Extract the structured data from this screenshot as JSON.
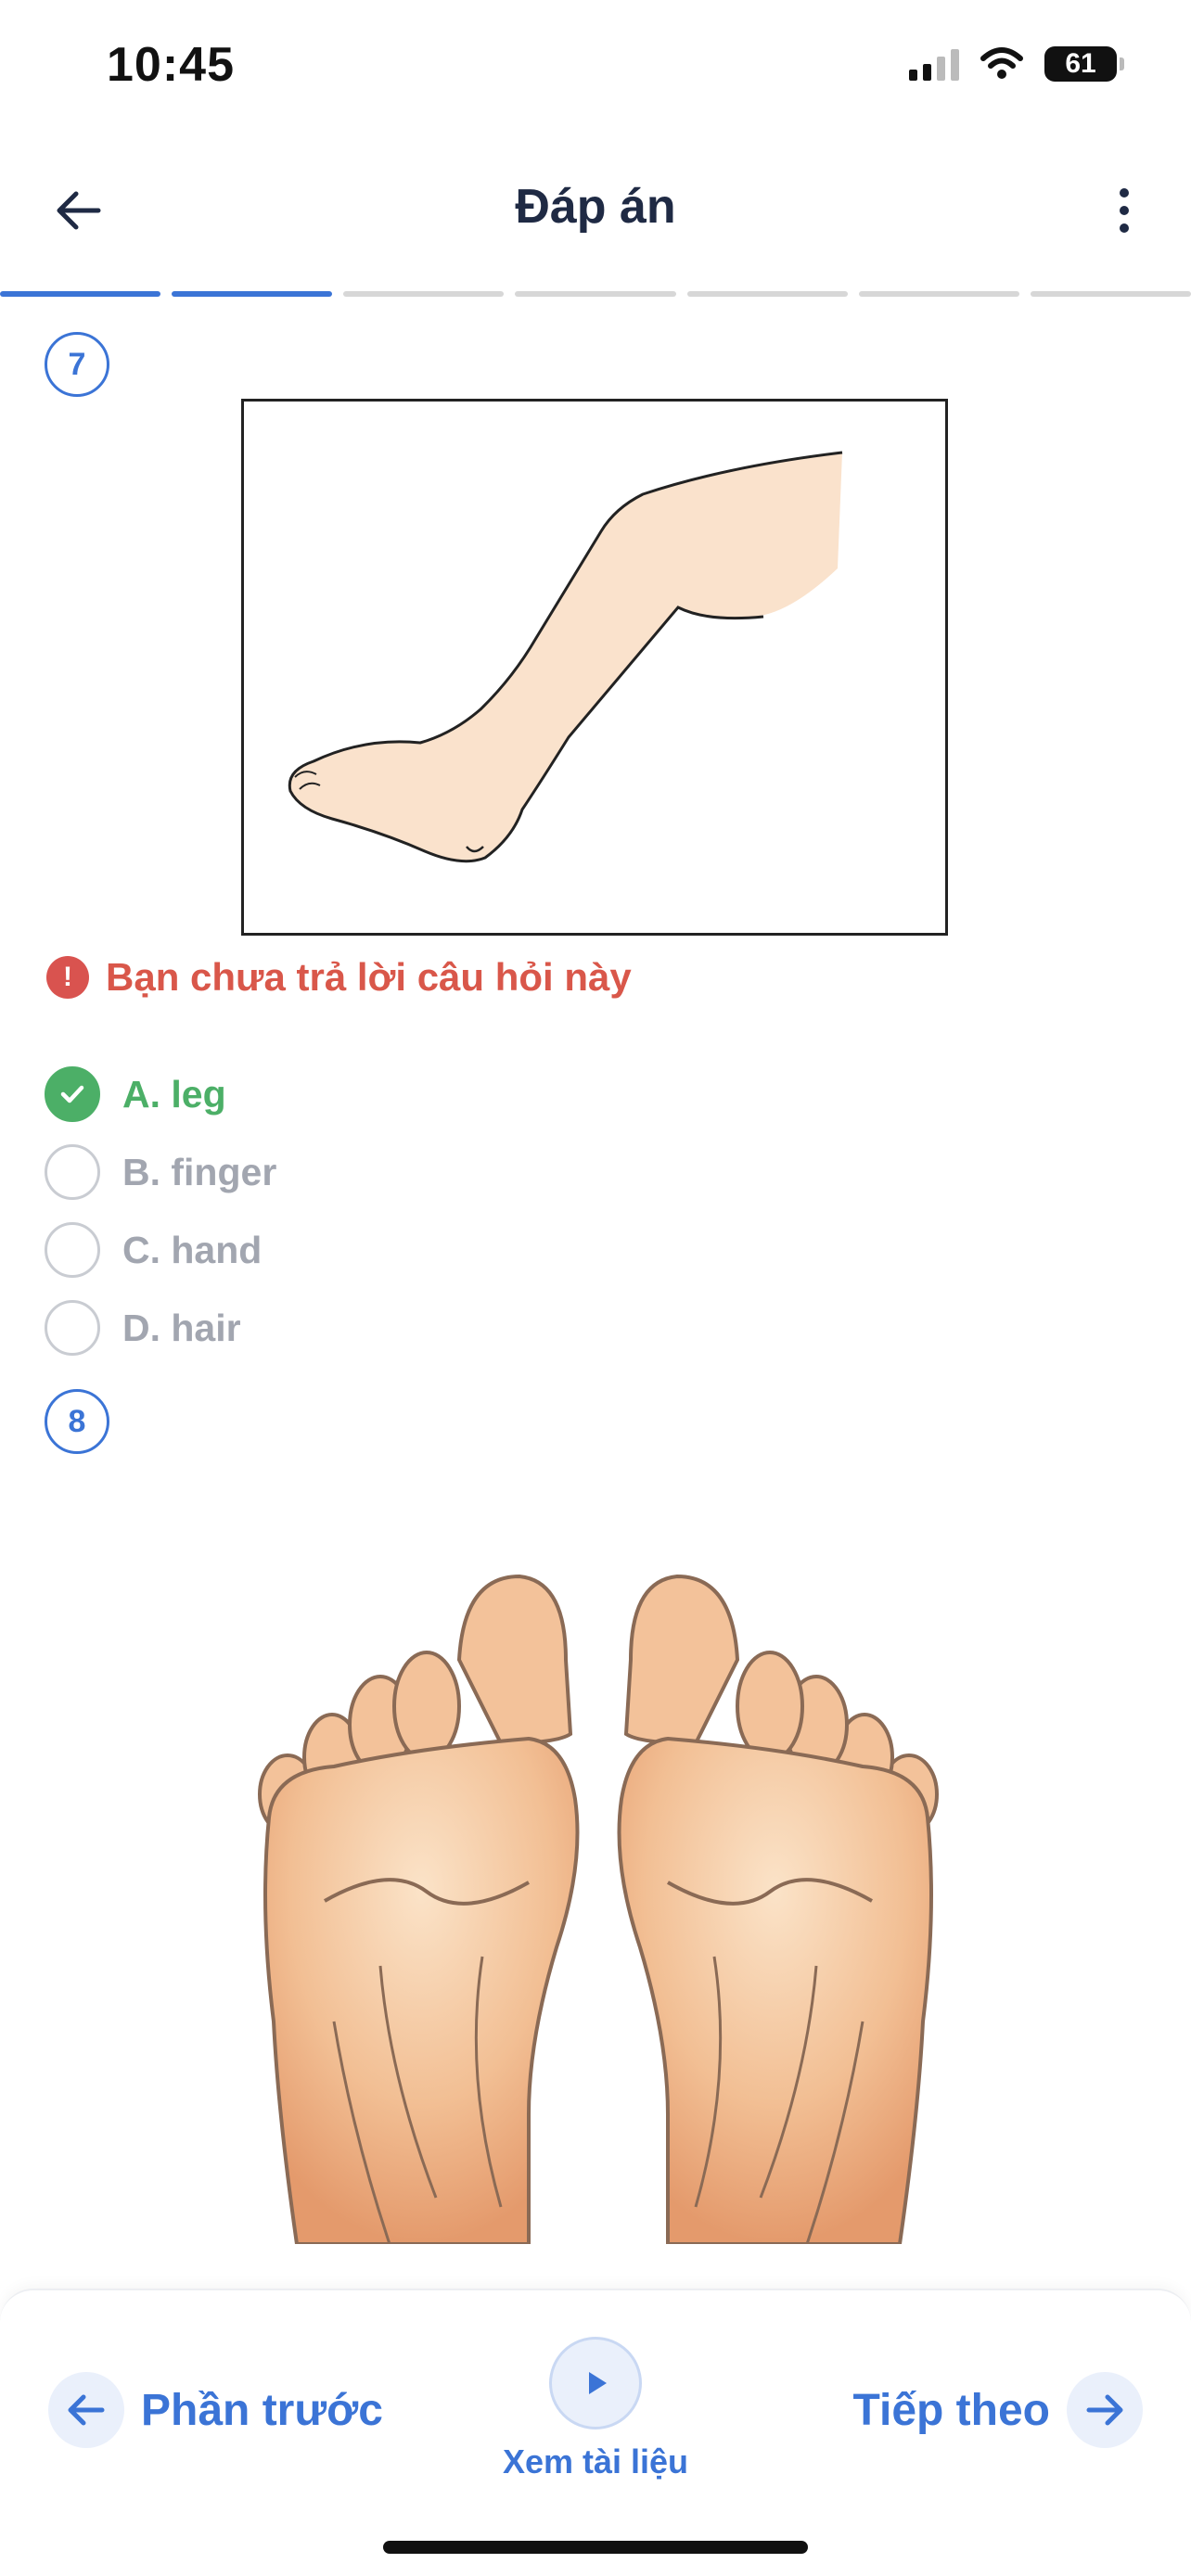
{
  "status_bar": {
    "time": "10:45",
    "battery": "61",
    "icons": [
      "signal-icon",
      "wifi-icon",
      "battery-icon"
    ]
  },
  "header": {
    "title": "Đáp án",
    "back_icon": "arrow-left-icon",
    "more_icon": "more-vertical-icon"
  },
  "progress": {
    "total_segments": 7,
    "completed_segments": 2
  },
  "questions": [
    {
      "number": "7",
      "image": "leg-illustration",
      "warning": "Bạn chưa trả lời câu hỏi này",
      "options": [
        {
          "label": "A. leg",
          "state": "correct"
        },
        {
          "label": "B. finger",
          "state": "unselected"
        },
        {
          "label": "C. hand",
          "state": "unselected"
        },
        {
          "label": "D. hair",
          "state": "unselected"
        }
      ]
    },
    {
      "number": "8",
      "image": "feet-soles-illustration"
    }
  ],
  "bottom_bar": {
    "prev_label": "Phần trước",
    "doc_label": "Xem tài liệu",
    "next_label": "Tiếp theo"
  },
  "colors": {
    "accent": "#3b74d6",
    "correct": "#4caf67",
    "warning": "#d9574a",
    "muted": "#a2a6b0"
  }
}
